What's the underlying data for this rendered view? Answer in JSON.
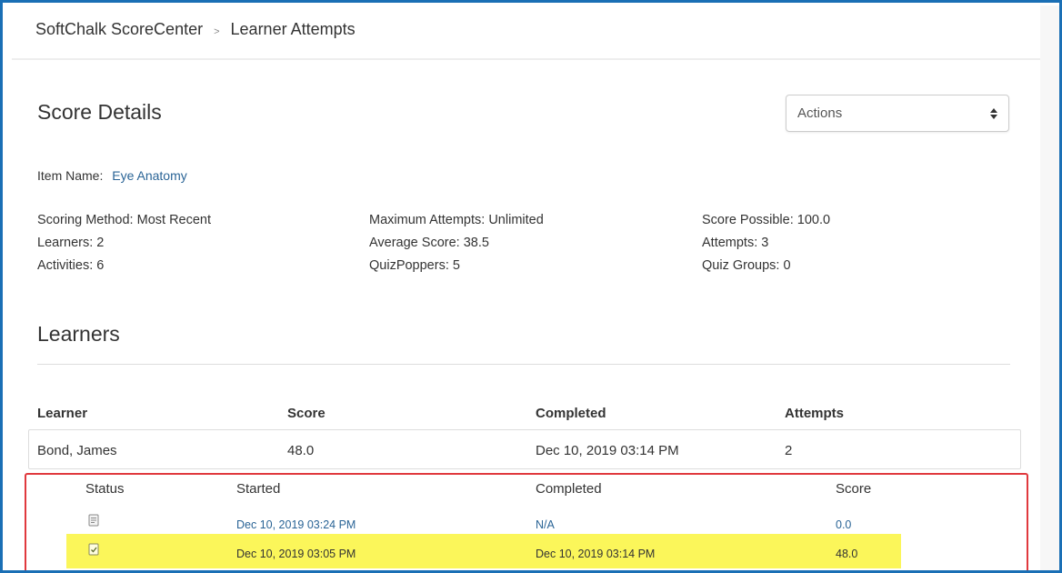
{
  "breadcrumb": {
    "root": "SoftChalk ScoreCenter",
    "separator": ">",
    "current": "Learner Attempts"
  },
  "score_details": {
    "title": "Score Details",
    "actions_label": "Actions",
    "item_name_label": "Item Name:",
    "item_name_value": "Eye Anatomy",
    "stats": {
      "scoring_method": "Scoring Method: Most Recent",
      "learners": "Learners: 2",
      "activities": "Activities:  6",
      "maximum_attempts": "Maximum Attempts: Unlimited",
      "average_score": "Average Score: 38.5",
      "quizpoppers": "QuizPoppers:  5",
      "score_possible": "Score Possible: 100.0",
      "attempts": "Attempts: 3",
      "quiz_groups": "Quiz Groups:  0"
    }
  },
  "learners": {
    "title": "Learners",
    "columns": [
      "Learner",
      "Score",
      "Completed",
      "Attempts"
    ],
    "rows": [
      {
        "learner": "Bond, James",
        "score": "48.0",
        "completed": "Dec 10, 2019 03:14 PM",
        "attempts": "2"
      }
    ]
  },
  "attempts": {
    "columns": [
      "Status",
      "Started",
      "Completed",
      "Score"
    ],
    "rows": [
      {
        "status_icon": "in-progress-document-icon",
        "started": "Dec 10, 2019 03:24 PM",
        "completed": "N/A",
        "score": "0.0",
        "highlighted": false
      },
      {
        "status_icon": "completed-check-icon",
        "started": "Dec 10, 2019 03:05 PM",
        "completed": "Dec 10, 2019 03:14 PM",
        "score": "48.0",
        "highlighted": true
      }
    ]
  },
  "colors": {
    "link_blue": "#2a6496",
    "frame_border": "#1a6fb5",
    "highlight_border": "#e0393e",
    "highlight_fill": "#fbf65a"
  }
}
